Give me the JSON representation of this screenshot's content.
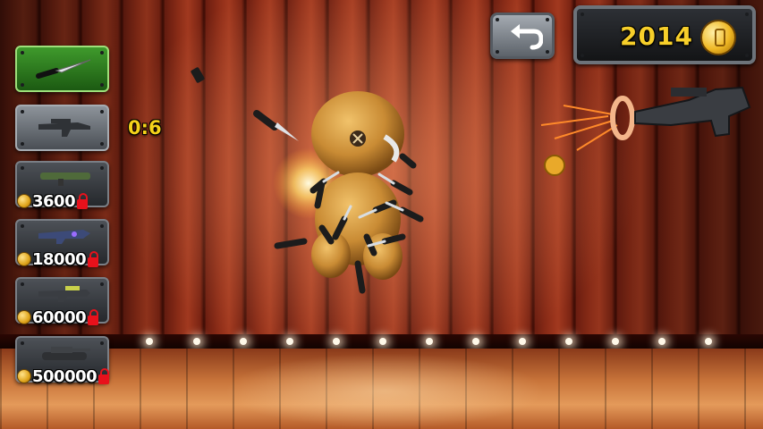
{
  "hud": {
    "back_icon": "undo-arrow-icon",
    "coins": "2014",
    "coin_icon": "gold-coin-icon",
    "hit_ratio": "0:6"
  },
  "weapons": [
    {
      "name": "knife",
      "icon": "knife-icon",
      "state": "selected",
      "price": ""
    },
    {
      "name": "submachine-gun",
      "icon": "smg-icon",
      "state": "owned",
      "price": ""
    },
    {
      "name": "rocket-launcher",
      "icon": "rocket-launcher-icon",
      "state": "locked",
      "price": "3600"
    },
    {
      "name": "plasma-rifle",
      "icon": "plasma-rifle-icon",
      "state": "locked",
      "price": "18000"
    },
    {
      "name": "heavy-gun",
      "icon": "heavy-gun-icon",
      "state": "locked",
      "price": "60000"
    },
    {
      "name": "tank",
      "icon": "tank-icon",
      "state": "locked",
      "price": "500000"
    }
  ],
  "colors": {
    "selected_slot": "#3f9a2c",
    "lock": "#e8111b",
    "score_text": "#f7cf2a",
    "price_text": "#ffffff"
  }
}
